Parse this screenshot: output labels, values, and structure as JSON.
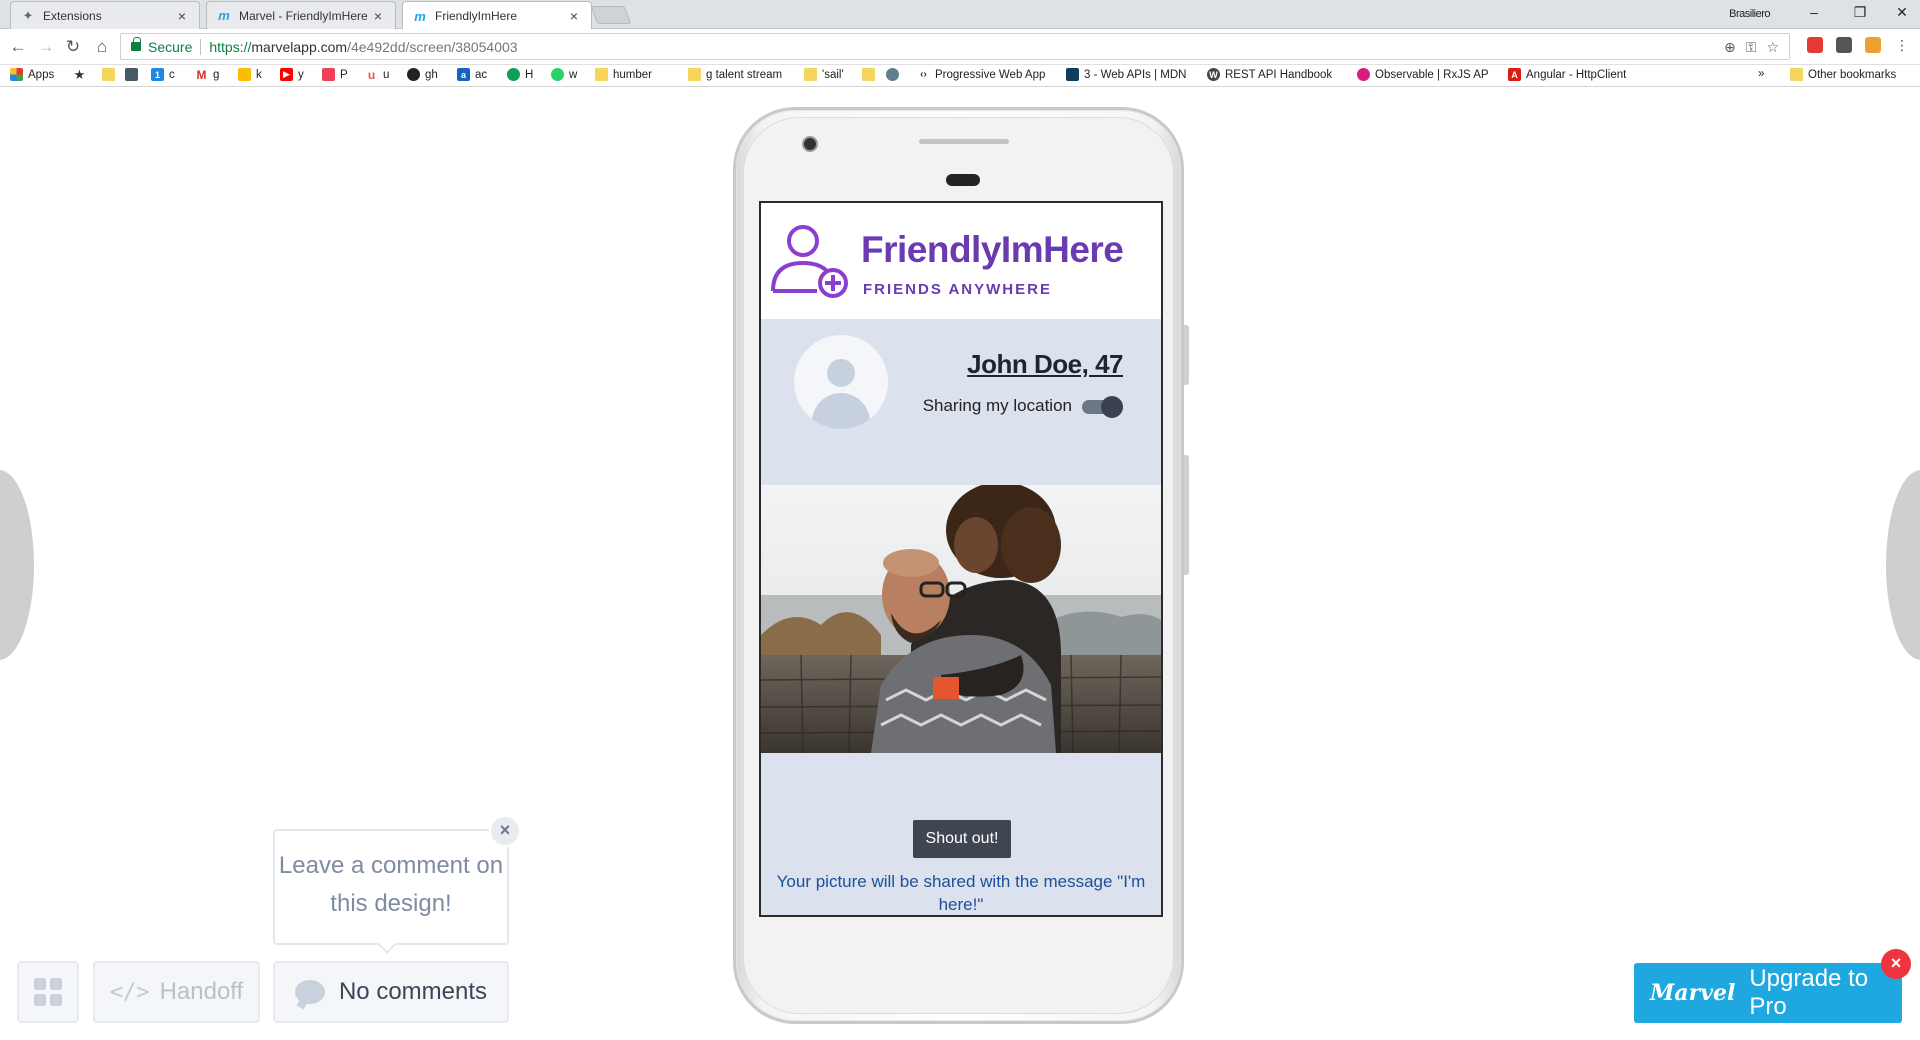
{
  "browser": {
    "tabs": [
      {
        "title": "Extensions",
        "close": "×"
      },
      {
        "title": "Marvel - FriendlyImHere",
        "close": "×"
      },
      {
        "title": "FriendlyImHere",
        "close": "×"
      }
    ],
    "user": "Brasiliero",
    "window_controls": {
      "minimize": "–",
      "restore": "❐",
      "close": "✕"
    },
    "secure_label": "Secure",
    "url_scheme": "https://",
    "url_host": "marvelapp.com",
    "url_path": "/4e492dd/screen/38054003"
  },
  "bookmarks": [
    {
      "label": "Apps",
      "icon": "apps-icon"
    },
    {
      "label": "",
      "icon": "star-icon"
    },
    {
      "label": "",
      "icon": "folder-icon"
    },
    {
      "label": "",
      "icon": "extension-icon"
    },
    {
      "label": "c",
      "icon": "calendar-icon"
    },
    {
      "label": "g",
      "icon": "gmail-icon"
    },
    {
      "label": "k",
      "icon": "keep-icon"
    },
    {
      "label": "y",
      "icon": "youtube-icon"
    },
    {
      "label": "P",
      "icon": "pocket-icon"
    },
    {
      "label": "u",
      "icon": "udemy-icon"
    },
    {
      "label": "gh",
      "icon": "github-icon"
    },
    {
      "label": "ac",
      "icon": "amazon-icon"
    },
    {
      "label": "H",
      "icon": "hangouts-icon"
    },
    {
      "label": "w",
      "icon": "whatsapp-icon"
    },
    {
      "label": "humber",
      "icon": "folder-icon"
    },
    {
      "label": "g talent stream",
      "icon": "folder-icon"
    },
    {
      "label": "'sail'",
      "icon": "folder-icon"
    },
    {
      "label": "",
      "icon": "folder-icon"
    },
    {
      "label": "",
      "icon": "globe-icon"
    },
    {
      "label": "Progressive Web App",
      "icon": "code-icon"
    },
    {
      "label": "3 - Web APIs | MDN",
      "icon": "mdn-icon"
    },
    {
      "label": "REST API Handbook",
      "icon": "wordpress-icon"
    },
    {
      "label": "Observable | RxJS AP",
      "icon": "rxjs-icon"
    },
    {
      "label": "Angular - HttpClient",
      "icon": "angular-icon"
    }
  ],
  "bookmarks_overflow": "»",
  "other_bookmarks": "Other bookmarks",
  "app": {
    "brand": "FriendlyImHere",
    "tagline": "FRIENDS ANYWHERE",
    "user_name": "John Doe, 47",
    "sharing_label": "Sharing my location",
    "sharing_on": true,
    "shout_button": "Shout out!",
    "share_message": "Your picture will be shared with the message \"I'm here!\"",
    "colors": {
      "brand": "#6a3ab0",
      "panel": "#dbe2ed",
      "button": "#3f4651",
      "message": "#1e4f9b"
    }
  },
  "viewer": {
    "comment_prompt": "Leave a comment on this design!",
    "popover_close": "×",
    "handoff_label": "Handoff",
    "comments_label": "No comments",
    "upgrade_logo": "Marvel",
    "upgrade_label": "Upgrade to Pro",
    "upgrade_close": "×",
    "colors": {
      "upgrade": "#1fa8df",
      "upgrade_close": "#f0343f"
    }
  }
}
